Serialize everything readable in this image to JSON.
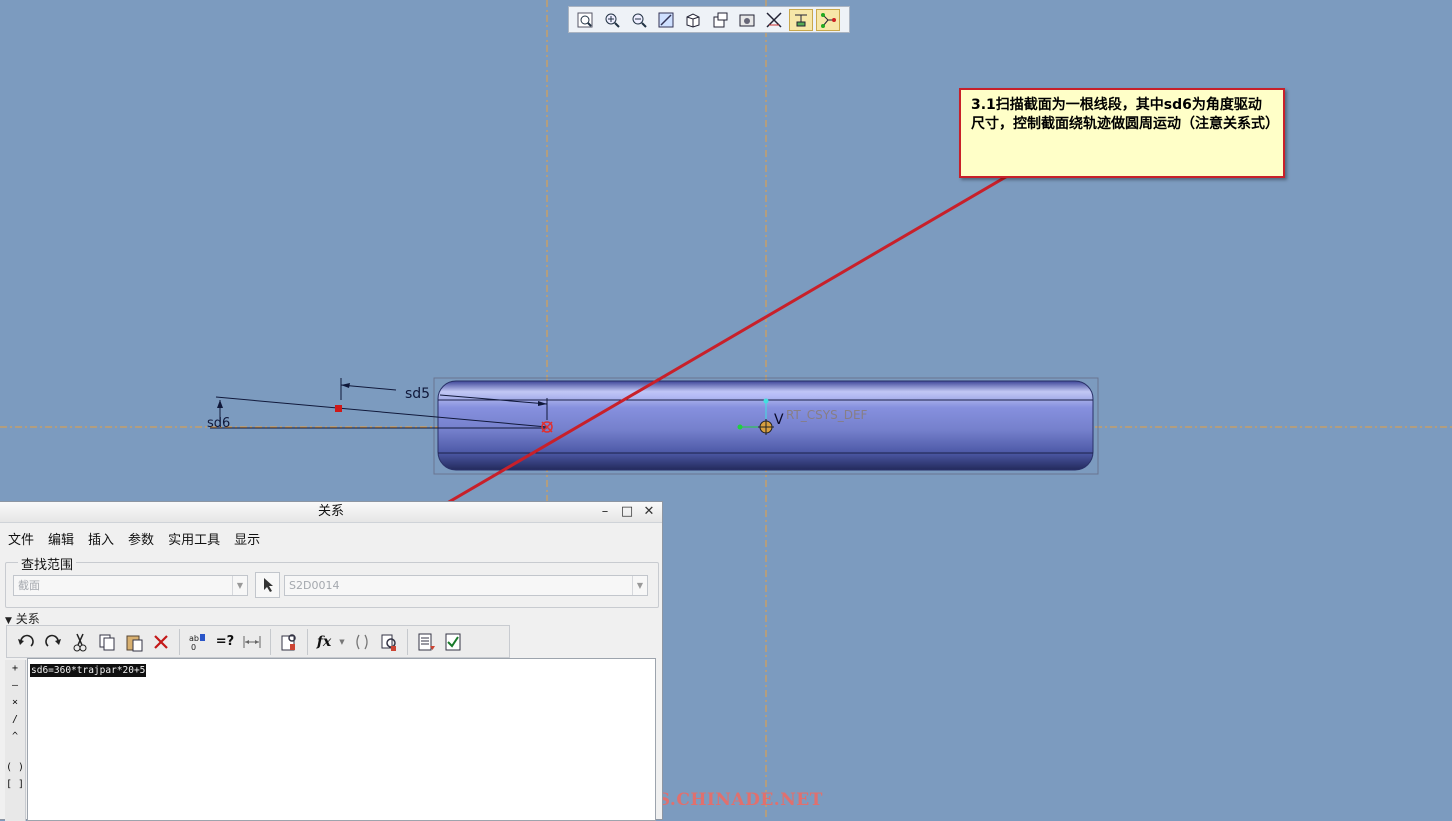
{
  "viewport": {
    "toolbar_icons": [
      "zoom-fit-icon",
      "zoom-in-icon",
      "zoom-out-icon",
      "repaint-icon",
      "view-orientation-icon",
      "saved-views-icon",
      "display-style-icon",
      "datum-display-icon",
      "constraint-display-icon",
      "vertex-display-icon"
    ],
    "dims": {
      "sd5": "sd5",
      "sd6": "sd6"
    },
    "csys_label": "RT_CSYS_DEF",
    "v_label": "V",
    "colors": {
      "background": "#7c9bbf",
      "centerline": "#e8a040",
      "arrow": "#c8202a",
      "tube": "#6570b8"
    }
  },
  "callout": {
    "text": "3.1扫描截面为一根线段，其中sd6为角度驱动尺寸，控制截面绕轨迹做圆周运动（注意关系式）"
  },
  "watermark": "BBS.CHINADE.NET",
  "dialog": {
    "title": "关系",
    "window_buttons": {
      "minimize": "–",
      "maximize": "□",
      "close": "✕"
    },
    "menu": [
      "文件",
      "编辑",
      "插入",
      "参数",
      "实用工具",
      "显示"
    ],
    "scope": {
      "legend": "查找范围",
      "type_value": "截面",
      "object_value": "S2D0014"
    },
    "relations_header": "关系",
    "toolbar_icons": [
      "undo-icon",
      "redo-icon",
      "cut-icon",
      "copy-icon",
      "paste-icon",
      "delete-icon",
      "evaluate-icon",
      "verify-icon",
      "unit-sensitivity-icon",
      "local-params-icon",
      "function-icon",
      "parentheses-icon",
      "params-icon",
      "sort-icon",
      "verify-relations-icon"
    ],
    "fx_label": "fx",
    "eq_label": "=?",
    "operators": [
      "+",
      "–",
      "×",
      "/",
      "^",
      "( )",
      "[ ]"
    ],
    "relation_text": "sd6=360*trajpar*20+5"
  }
}
